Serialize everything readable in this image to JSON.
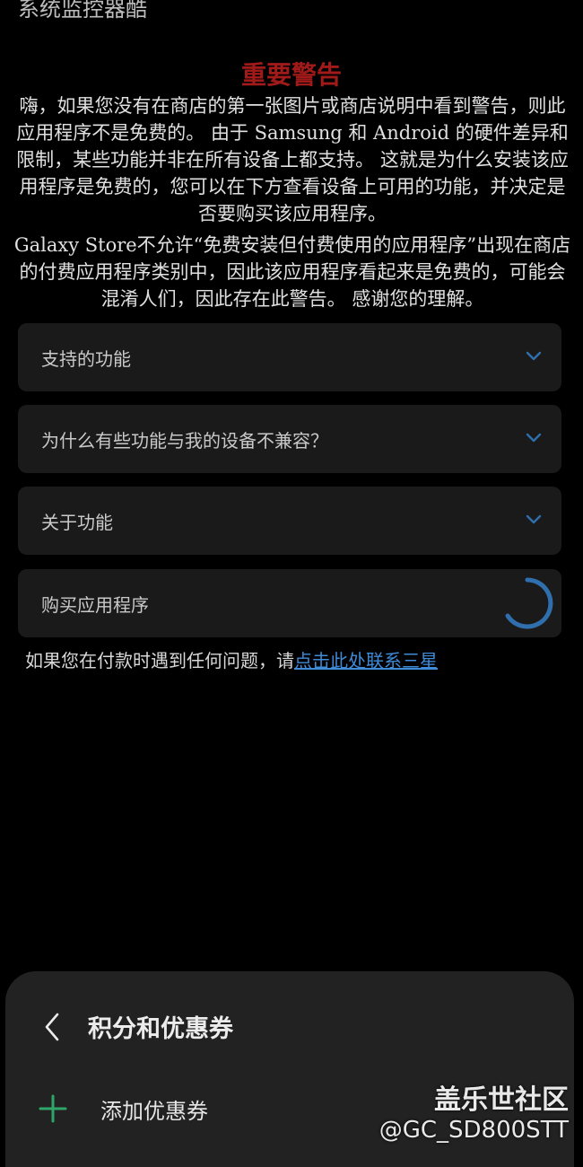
{
  "app": {
    "title": "系统监控器酷"
  },
  "warning": {
    "title": "重要警告",
    "body": "嗨，如果您没有在商店的第一张图片或商店说明中看到警告，则此应用程序不是免费的。 由于 Samsung 和 Android 的硬件差异和限制，某些功能并非在所有设备上都支持。 这就是为什么安装该应用程序是免费的，您可以在下方查看设备上可用的功能，并决定是否要购买该应用程序。",
    "store_note": "Galaxy Store不允许“免费安装但付费使用的应用程序”出现在商店的付费应用程序类别中，因此该应用程序看起来是免费的，可能会混淆人们，因此存在此警告。 感谢您的理解。"
  },
  "accordions": [
    {
      "label": "支持的功能",
      "icon": "chevron-down-icon"
    },
    {
      "label": "为什么有些功能与我的设备不兼容？",
      "icon": "chevron-down-icon"
    },
    {
      "label": "关于功能",
      "icon": "chevron-down-icon"
    },
    {
      "label": "购买应用程序",
      "icon": "loading-spinner-icon"
    }
  ],
  "contact": {
    "prefix": "如果您在付款时遇到任何问题，请",
    "link": "点击此处联系三星"
  },
  "sheet": {
    "title": "积分和优惠券",
    "back_icon": "back-icon",
    "add_coupon_label": "添加优惠券",
    "add_icon": "plus-icon"
  },
  "watermark": {
    "title": "盖乐世社区",
    "handle": "@GC_SD800STT"
  },
  "colors": {
    "background": "#000000",
    "warning_title": "#a11a1a",
    "card_bg": "#1a1a1a",
    "accent_blue": "#2f6fae",
    "link_blue": "#3f8bd8",
    "plus_green": "#2fa56a",
    "sheet_bg": "#222222"
  }
}
